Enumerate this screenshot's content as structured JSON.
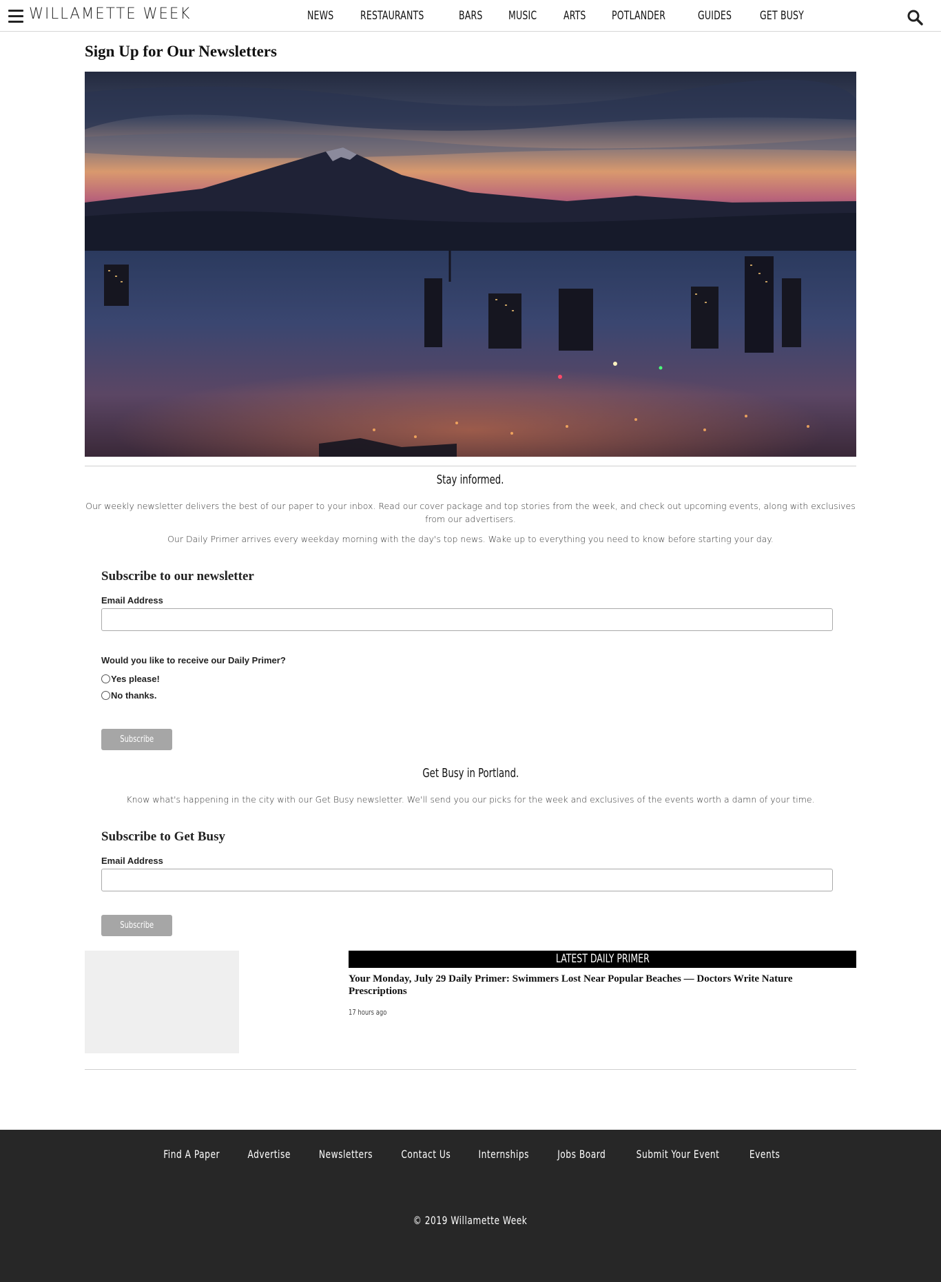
{
  "header": {
    "logo": "WILLAMETTE WEEK",
    "nav": [
      "NEWS",
      "RESTAURANTS",
      "BARS",
      "MUSIC",
      "ARTS",
      "POTLANDER",
      "GUIDES",
      "GET BUSY"
    ],
    "menu_icon": "hamburger-menu-icon",
    "search_icon": "search-icon"
  },
  "page": {
    "title": "Sign Up for Our Newsletters",
    "hero_image": "Portland skyline under fog at dusk with Mount Hood in the distance"
  },
  "newsletter": {
    "heading": "Stay informed.",
    "para1": "Our weekly newsletter delivers the best of our paper to your inbox. Read our cover package and top stories from the week, and check out upcoming events, along with exclusives from our advertisers.",
    "para2": "Our Daily Primer arrives every weekday morning with the day's top news. Wake up to everything you need to know before starting your day.",
    "form_heading": "Subscribe to our newsletter",
    "email_label": "Email Address",
    "email_value": "",
    "question": "Would you like to receive our Daily Primer?",
    "option_yes": "Yes please!",
    "option_no": "No thanks.",
    "button": "Subscribe"
  },
  "getbusy": {
    "heading": "Get Busy in Portland.",
    "para": "Know what's happening in the city with our Get Busy newsletter. We'll send you our picks for the week and exclusives of the events worth a damn of your time.",
    "form_heading": "Subscribe to Get Busy",
    "email_label": "Email Address",
    "email_value": "",
    "button": "Subscribe"
  },
  "primer": {
    "bar_label": "LATEST DAILY PRIMER",
    "headline": "Your Monday, July 29 Daily Primer: Swimmers Lost Near Popular Beaches — Doctors Write Nature Prescriptions",
    "time": "17 hours ago"
  },
  "footer": {
    "links": [
      "Find A Paper",
      "Advertise",
      "Newsletters",
      "Contact Us",
      "Internships",
      "Jobs Board",
      "Submit Your Event",
      "Events"
    ],
    "copyright": "© 2019 Willamette Week"
  },
  "colors": {
    "footer_bg": "#272727",
    "button_bg": "#a6a6a6",
    "primer_bar_bg": "#000000"
  }
}
